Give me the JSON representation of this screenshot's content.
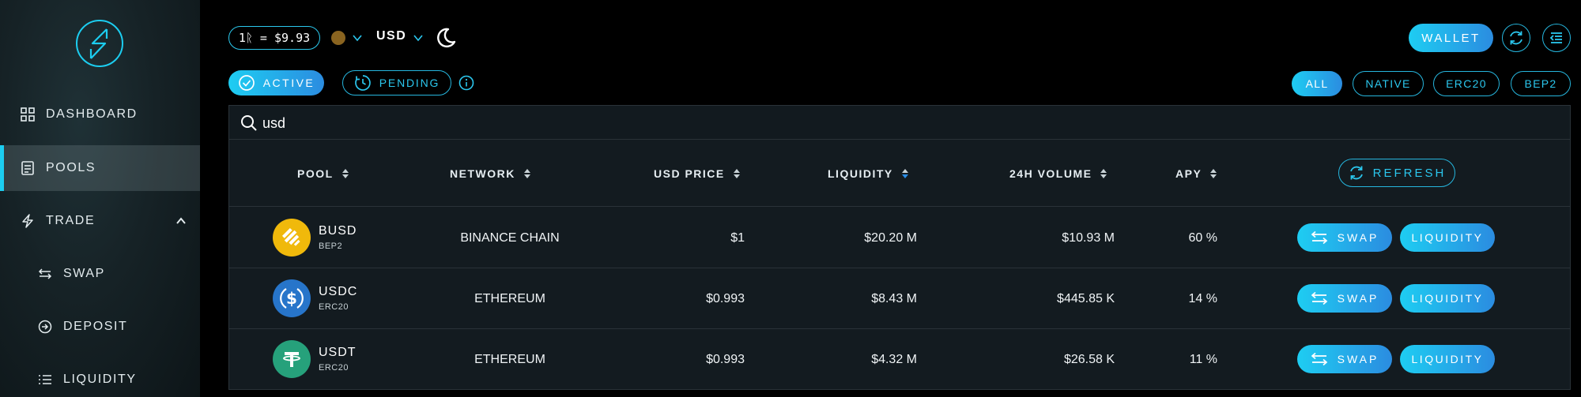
{
  "sidebar": {
    "items": [
      {
        "label": "DASHBOARD",
        "icon": "grid-icon"
      },
      {
        "label": "POOLS",
        "icon": "receipt-icon"
      },
      {
        "label": "TRADE",
        "icon": "lightning-icon"
      },
      {
        "label": "SWAP",
        "icon": "swap-arrows-icon"
      },
      {
        "label": "DEPOSIT",
        "icon": "deposit-icon"
      },
      {
        "label": "LIQUIDITY",
        "icon": "list-icon"
      }
    ]
  },
  "topbar": {
    "rate": "1ᚱ = $9.93",
    "currency": "USD",
    "wallet_label": "WALLET"
  },
  "status_tabs": {
    "active_label": "ACTIVE",
    "pending_label": "PENDING"
  },
  "filters": [
    "ALL",
    "NATIVE",
    "ERC20",
    "BEP2"
  ],
  "search": {
    "value": "usd"
  },
  "table": {
    "headers": [
      "POOL",
      "NETWORK",
      "USD PRICE",
      "LIQUIDITY",
      "24H VOLUME",
      "APY"
    ],
    "refresh_label": "REFRESH",
    "swap_label": "SWAP",
    "liquidity_label": "LIQUIDITY",
    "rows": [
      {
        "symbol": "BUSD",
        "standard": "BEP2",
        "network": "BINANCE CHAIN",
        "price": "$1",
        "liquidity": "$20.20 M",
        "volume": "$10.93 M",
        "apy": "60 %"
      },
      {
        "symbol": "USDC",
        "standard": "ERC20",
        "network": "ETHEREUM",
        "price": "$0.993",
        "liquidity": "$8.43 M",
        "volume": "$445.85 K",
        "apy": "14 %"
      },
      {
        "symbol": "USDT",
        "standard": "ERC20",
        "network": "ETHEREUM",
        "price": "$0.993",
        "liquidity": "$4.32 M",
        "volume": "$26.58 K",
        "apy": "11 %"
      }
    ]
  },
  "colors": {
    "accent": "#1ccdf0",
    "busd": "#f0b90b",
    "usdc": "#2775ca",
    "usdt": "#26a17b"
  }
}
